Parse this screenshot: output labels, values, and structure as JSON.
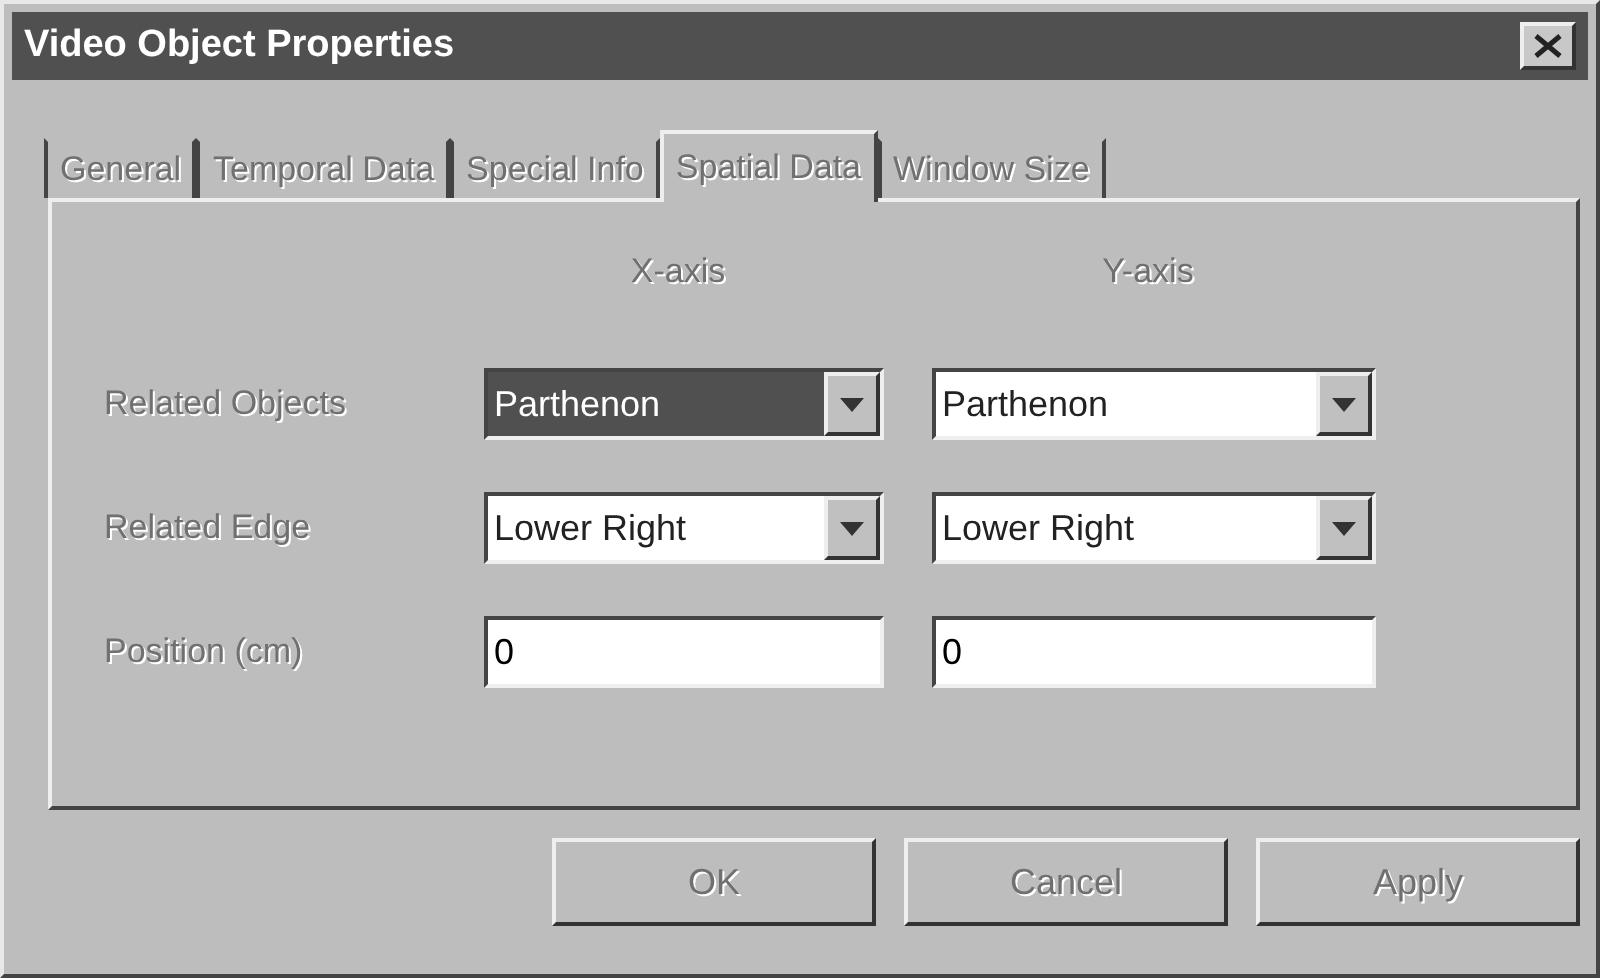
{
  "window": {
    "title": "Video Object Properties"
  },
  "tabs": [
    {
      "label": "General",
      "selected": false
    },
    {
      "label": "Temporal Data",
      "selected": false
    },
    {
      "label": "Special Info",
      "selected": false
    },
    {
      "label": "Spatial Data",
      "selected": true
    },
    {
      "label": "Window Size",
      "selected": false
    }
  ],
  "columns": [
    "X-axis",
    "Y-axis"
  ],
  "rows": [
    {
      "label": "Related Objects",
      "x": {
        "kind": "combo",
        "value": "Parthenon",
        "highlighted": true
      },
      "y": {
        "kind": "combo",
        "value": "Parthenon",
        "highlighted": false
      }
    },
    {
      "label": "Related Edge",
      "x": {
        "kind": "combo",
        "value": "Lower Right",
        "highlighted": false
      },
      "y": {
        "kind": "combo",
        "value": "Lower Right",
        "highlighted": false
      }
    },
    {
      "label": "Position (cm)",
      "x": {
        "kind": "text",
        "value": "0"
      },
      "y": {
        "kind": "text",
        "value": "0"
      }
    }
  ],
  "buttons": [
    "OK",
    "Cancel",
    "Apply"
  ]
}
